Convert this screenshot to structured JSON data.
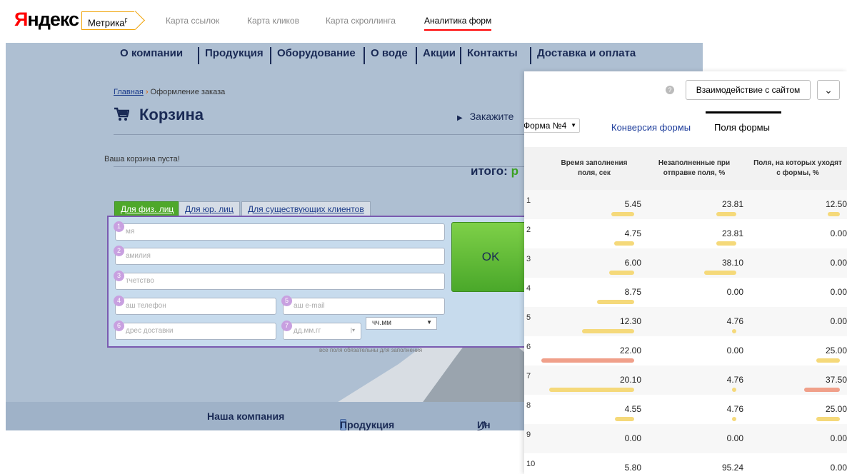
{
  "topbar": {
    "logo": "Яндекс",
    "metrika_label": "Метрика",
    "metrika_sup": "β",
    "links": [
      "Карта ссылок",
      "Карта кликов",
      "Карта скроллинга",
      "Аналитика форм"
    ],
    "active_link": "Аналитика форм",
    "accent_color": "#ff0000"
  },
  "site": {
    "nav": [
      "О компании",
      "Продукция",
      "Оборудование",
      "О воде",
      "Акции",
      "Контакты",
      "Доставка и оплата"
    ],
    "breadcrumb_home": "Главная",
    "breadcrumb_current": "Оформление заказа",
    "page_title": "Корзина",
    "order_link": "Закажите",
    "empty_cart_text": "Ваша корзина пуста!",
    "total_label": "итого:",
    "total_value_partial": "р",
    "tabs": [
      "Для физ. лиц",
      "Для юр. лиц",
      "Для существующих клиентов"
    ],
    "active_tab": "Для физ. лиц",
    "fields": [
      {
        "num": "1",
        "placeholder": "мя"
      },
      {
        "num": "2",
        "placeholder": "амилия"
      },
      {
        "num": "3",
        "placeholder": "тчетство"
      },
      {
        "num": "4",
        "placeholder": "аш телефон"
      },
      {
        "num": "5",
        "placeholder": "аш e-mail"
      },
      {
        "num": "6",
        "placeholder": "дрес доставки"
      },
      {
        "num": "7",
        "placeholder": "дд.мм.гг"
      }
    ],
    "time_select": "чч.мм",
    "submit_label": "OK",
    "required_note": "все поля обязательны для заполнения",
    "footer": [
      "Наша компания",
      "Продукция",
      "Ин"
    ]
  },
  "panel": {
    "help_icon": "?",
    "mode_dropdown": "Взаимодействие с сайтом",
    "form_select": "Форма №4",
    "tabs": [
      "Конверсия формы",
      "Поля формы"
    ],
    "active_tab": "Поля формы",
    "columns": [
      "Время заполнения поля, сек",
      "Незаполненные при отправке поля, %",
      "Поля, на которых уходят с формы, %"
    ],
    "rows": [
      {
        "n": "1",
        "time": "5.45",
        "unfilled": "23.81",
        "exit": "12.50"
      },
      {
        "n": "2",
        "time": "4.75",
        "unfilled": "23.81",
        "exit": "0.00"
      },
      {
        "n": "3",
        "time": "6.00",
        "unfilled": "38.10",
        "exit": "0.00"
      },
      {
        "n": "4",
        "time": "8.75",
        "unfilled": "0.00",
        "exit": "0.00"
      },
      {
        "n": "5",
        "time": "12.30",
        "unfilled": "4.76",
        "exit": "0.00"
      },
      {
        "n": "6",
        "time": "22.00",
        "unfilled": "0.00",
        "exit": "25.00"
      },
      {
        "n": "7",
        "time": "20.10",
        "unfilled": "4.76",
        "exit": "37.50"
      },
      {
        "n": "8",
        "time": "4.55",
        "unfilled": "4.76",
        "exit": "25.00"
      },
      {
        "n": "9",
        "time": "0.00",
        "unfilled": "0.00",
        "exit": "0.00"
      },
      {
        "n": "10",
        "time": "5.80",
        "unfilled": "95.24",
        "exit": "0.00"
      }
    ],
    "bar_colors": {
      "normal": "#f5d97a",
      "high": "#f0a08a"
    }
  }
}
